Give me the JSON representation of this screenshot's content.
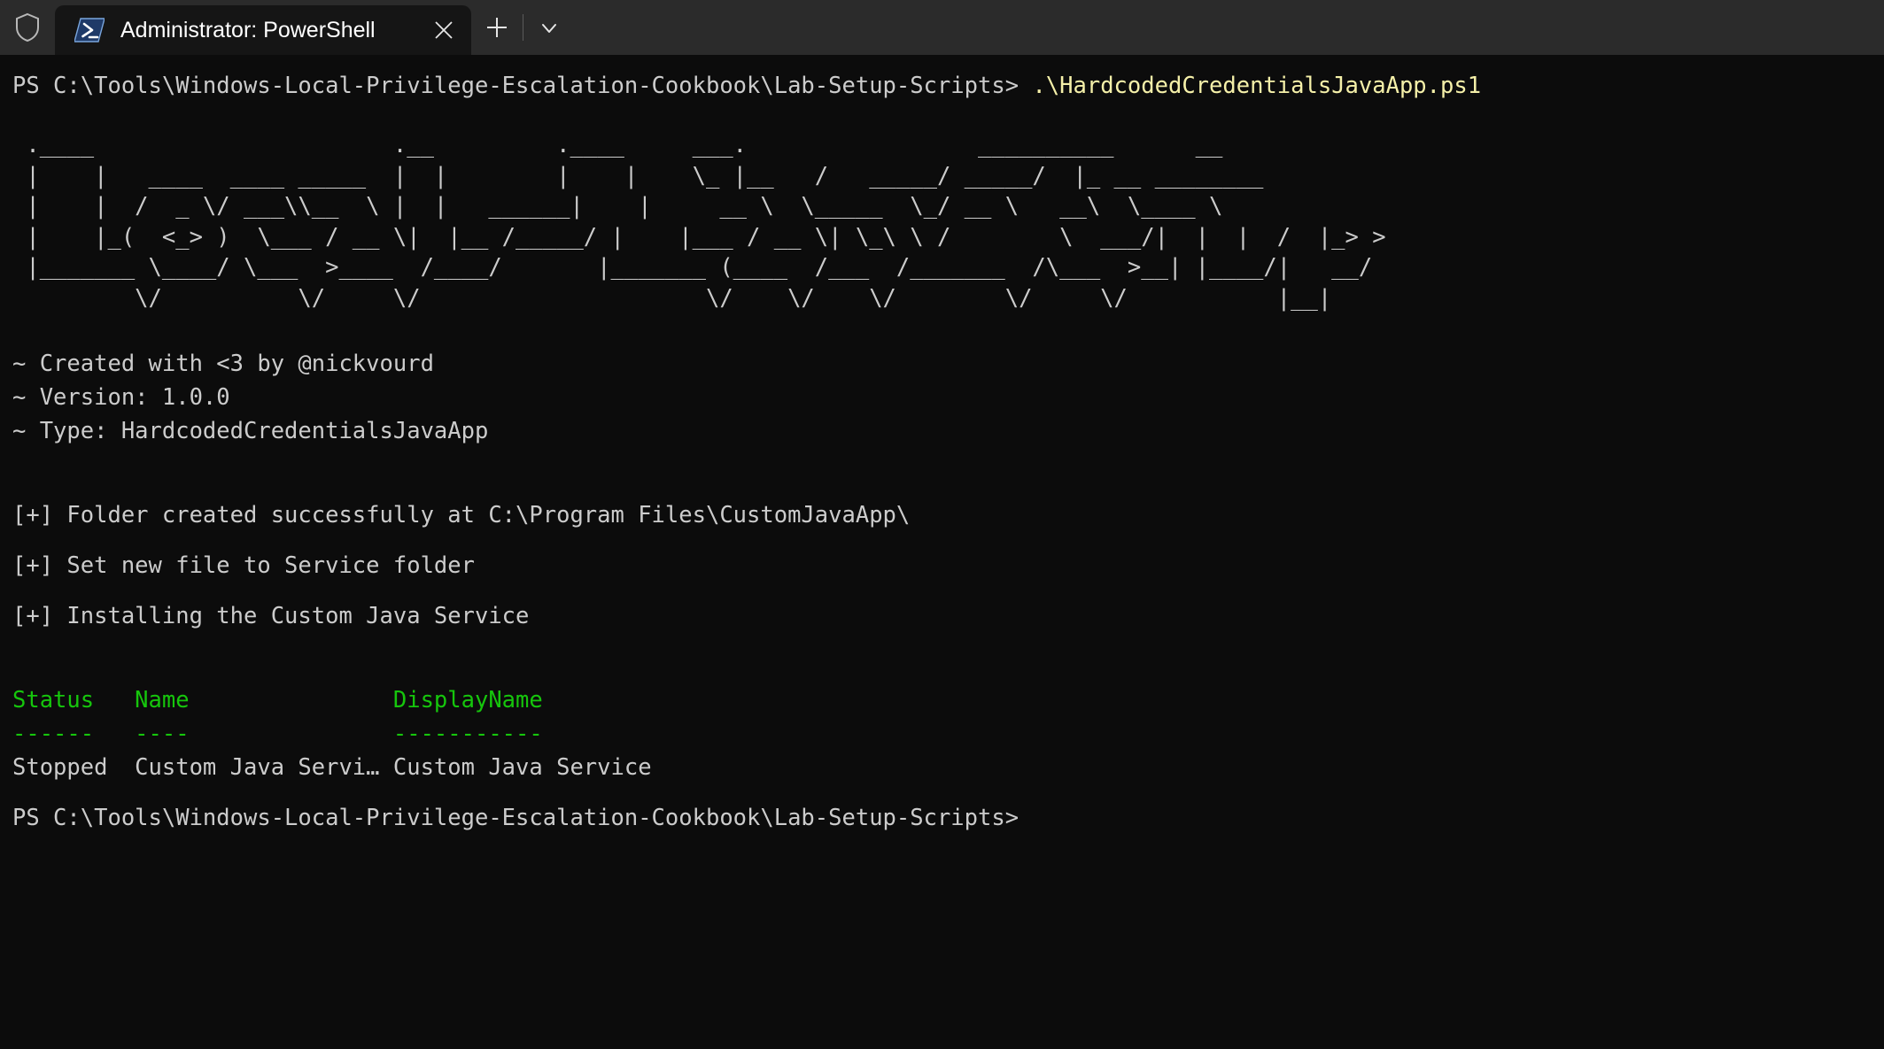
{
  "titlebar": {
    "shield_icon": "shield-icon",
    "tab": {
      "icon": "powershell-icon",
      "title": "Administrator: PowerShell",
      "close_icon": "close-icon"
    },
    "new_tab_icon": "plus-icon",
    "dropdown_icon": "chevron-down-icon"
  },
  "terminal": {
    "background": "#0c0c0c",
    "foreground": "#cccccc",
    "command_color": "#f5f0a9",
    "header_color": "#16c60c",
    "prompt_line": {
      "prompt": "PS C:\\Tools\\Windows-Local-Privilege-Escalation-Cookbook\\Lab-Setup-Scripts> ",
      "command": ".\\HardcodedCredentialsJavaApp.ps1"
    },
    "banner": " .____                      .__         .____     ___.                 __________      __\n |    |   ____  ____ _____  |  |        |    |    \\_ |__   /   _____/ _____/  |_ __ ________\n |    |  /  _ \\/ ___\\\\__  \\ |  |   ______|    |     __ \\  \\_____  \\_/ __ \\   __\\  \\____ \\\n |    |_(  <_> )  \\___ / __ \\|  |__ /_____/ |    |___ / __ \\| \\_\\ \\ /        \\  ___/|  |  |  /  |_> >\n |_______ \\____/ \\___  >____  /____/       |_______ (____  /___  /_______  /\\___  >__| |____/|   __/\n         \\/          \\/     \\/                     \\/    \\/    \\/        \\/     \\/           |__|",
    "info_lines": [
      "~ Created with <3 by @nickvourd",
      "~ Version: 1.0.0",
      "~ Type: HardcodedCredentialsJavaApp"
    ],
    "status_lines": [
      "[+] Folder created successfully at C:\\Program Files\\CustomJavaApp\\",
      "[+] Set new file to Service folder",
      "[+] Installing the Custom Java Service"
    ],
    "service_table": {
      "header": "Status   Name               DisplayName",
      "separator": "------   ----               -----------",
      "columns": [
        "Status",
        "Name",
        "DisplayName"
      ],
      "rows": [
        {
          "status": "Stopped",
          "name": "Custom Java Servi…",
          "display_name": "Custom Java Service",
          "line": "Stopped  Custom Java Servi… Custom Java Service"
        }
      ]
    },
    "final_prompt": "PS C:\\Tools\\Windows-Local-Privilege-Escalation-Cookbook\\Lab-Setup-Scripts>"
  }
}
